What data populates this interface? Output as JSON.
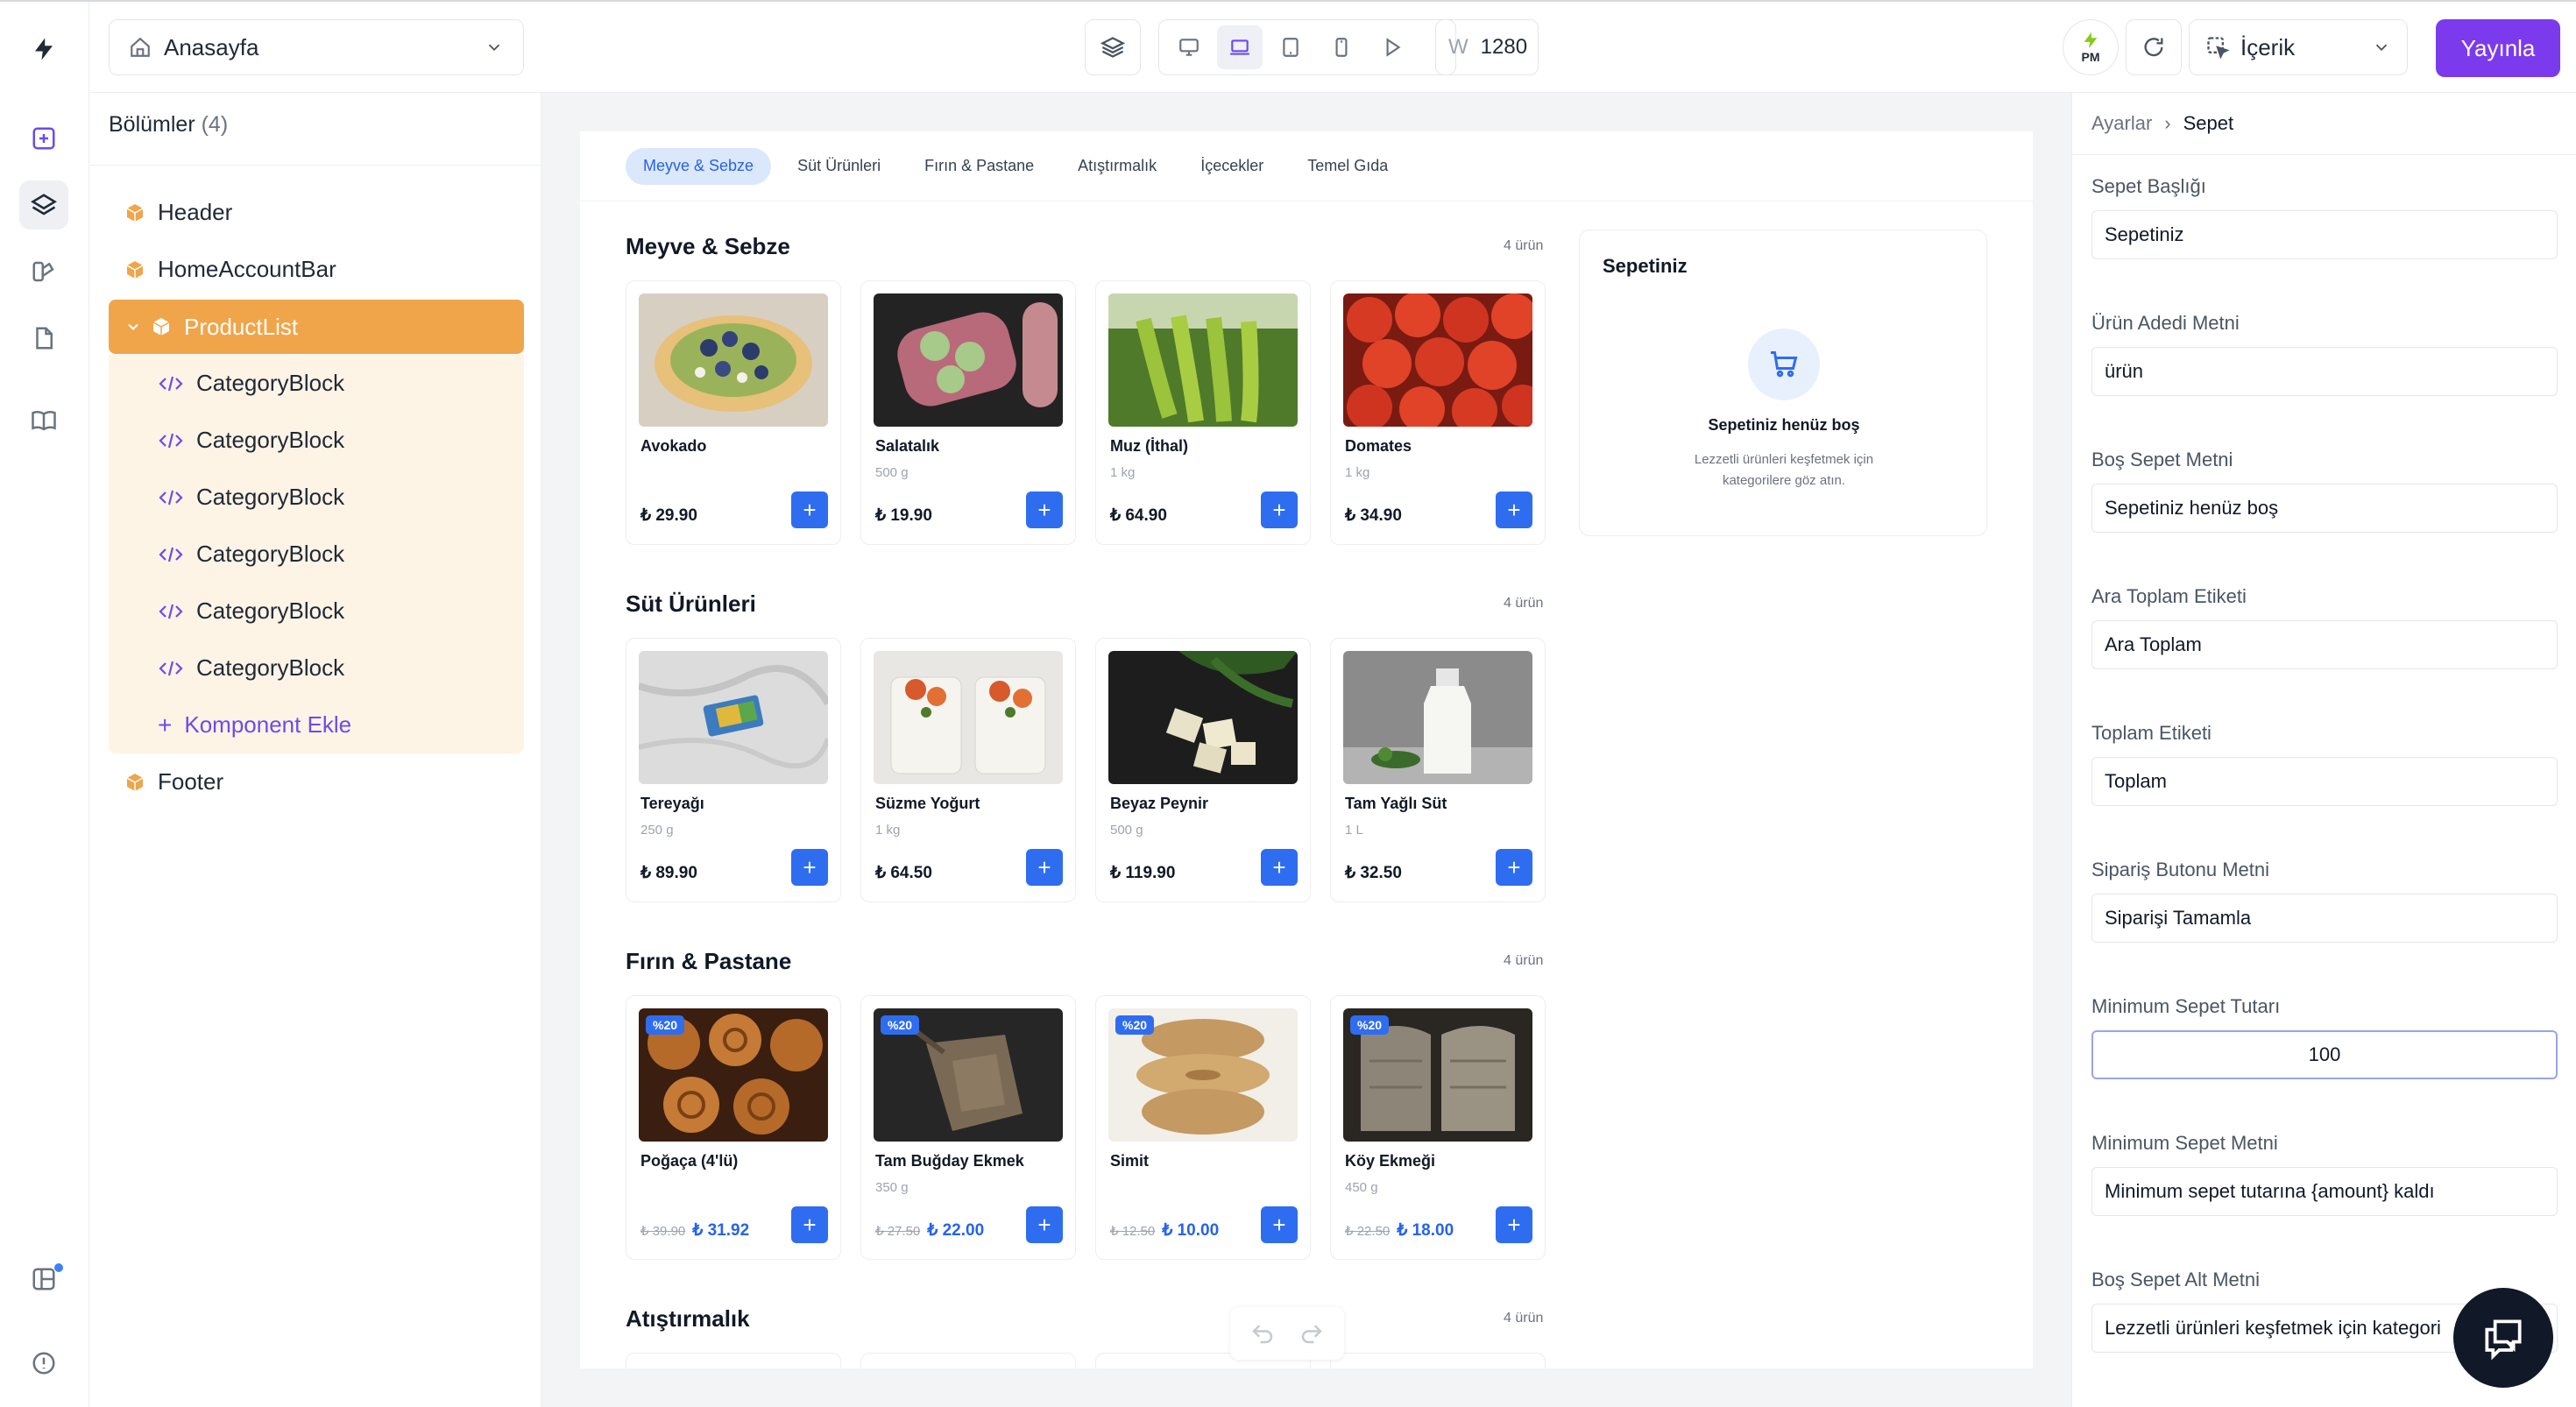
{
  "header": {
    "page_select": "Anasayfa",
    "width_label": "W",
    "width_value": "1280",
    "pm_label": "PM",
    "mode_select": "İçerik",
    "publish": "Yayınla"
  },
  "sections_panel": {
    "title": "Bölümler",
    "count": "(4)",
    "items": [
      {
        "label": "Header"
      },
      {
        "label": "HomeAccountBar"
      },
      {
        "label": "ProductList"
      },
      {
        "label": "Footer"
      }
    ],
    "children": [
      {
        "label": "CategoryBlock"
      },
      {
        "label": "CategoryBlock"
      },
      {
        "label": "CategoryBlock"
      },
      {
        "label": "CategoryBlock"
      },
      {
        "label": "CategoryBlock"
      },
      {
        "label": "CategoryBlock"
      }
    ],
    "add_component": "Komponent Ekle"
  },
  "preview": {
    "tabs": [
      "Meyve & Sebze",
      "Süt Ürünleri",
      "Fırın & Pastane",
      "Atıştırmalık",
      "İçecekler",
      "Temel Gıda"
    ],
    "sections": [
      {
        "title": "Meyve & Sebze",
        "count": "4 ürün",
        "products": [
          {
            "name": "Avokado",
            "unit": "",
            "price": "₺ 29.90",
            "old": ""
          },
          {
            "name": "Salatalık",
            "unit": "500 g",
            "price": "₺ 19.90",
            "old": ""
          },
          {
            "name": "Muz (İthal)",
            "unit": "1 kg",
            "price": "₺ 64.90",
            "old": ""
          },
          {
            "name": "Domates",
            "unit": "1 kg",
            "price": "₺ 34.90",
            "old": ""
          }
        ]
      },
      {
        "title": "Süt Ürünleri",
        "count": "4 ürün",
        "products": [
          {
            "name": "Tereyağı",
            "unit": "250 g",
            "price": "₺ 89.90",
            "old": ""
          },
          {
            "name": "Süzme Yoğurt",
            "unit": "1 kg",
            "price": "₺ 64.50",
            "old": ""
          },
          {
            "name": "Beyaz Peynir",
            "unit": "500 g",
            "price": "₺ 119.90",
            "old": ""
          },
          {
            "name": "Tam Yağlı Süt",
            "unit": "1 L",
            "price": "₺ 32.50",
            "old": ""
          }
        ]
      },
      {
        "title": "Fırın & Pastane",
        "count": "4 ürün",
        "products": [
          {
            "name": "Poğaça (4'lü)",
            "unit": "",
            "price": "₺ 31.92",
            "old": "₺ 39.90",
            "badge": "%20"
          },
          {
            "name": "Tam Buğday Ekmek",
            "unit": "350 g",
            "price": "₺ 22.00",
            "old": "₺ 27.50",
            "badge": "%20"
          },
          {
            "name": "Simit",
            "unit": "",
            "price": "₺ 10.00",
            "old": "₺ 12.50",
            "badge": "%20"
          },
          {
            "name": "Köy Ekmeği",
            "unit": "450 g",
            "price": "₺ 18.00",
            "old": "₺ 22.50",
            "badge": "%20"
          }
        ]
      },
      {
        "title": "Atıştırmalık",
        "count": "4 ürün"
      }
    ],
    "cart": {
      "title": "Sepetiniz",
      "empty": "Sepetiniz henüz boş",
      "sub": "Lezzetli ürünleri keşfetmek için kategorilere göz atın."
    }
  },
  "settings": {
    "breadcrumb_root": "Ayarlar",
    "breadcrumb_current": "Sepet",
    "fields": [
      {
        "label": "Sepet Başlığı",
        "value": "Sepetiniz"
      },
      {
        "label": "Ürün Adedi Metni",
        "value": "ürün"
      },
      {
        "label": "Boş Sepet Metni",
        "value": "Sepetiniz henüz boş"
      },
      {
        "label": "Ara Toplam Etiketi",
        "value": "Ara Toplam"
      },
      {
        "label": "Toplam Etiketi",
        "value": "Toplam"
      },
      {
        "label": "Sipariş Butonu Metni",
        "value": "Siparişi Tamamla"
      },
      {
        "label": "Minimum Sepet Tutarı",
        "value": "100"
      },
      {
        "label": "Minimum Sepet Metni",
        "value": "Minimum sepet tutarına {amount} kaldı"
      },
      {
        "label": "Boş Sepet Alt Metni",
        "value": "Lezzetli ürünleri keşfetmek için kategori"
      }
    ]
  },
  "colors": {
    "accent": "#7c3aed",
    "selected_section": "#f0a54a",
    "add_button": "#2f6df0"
  }
}
